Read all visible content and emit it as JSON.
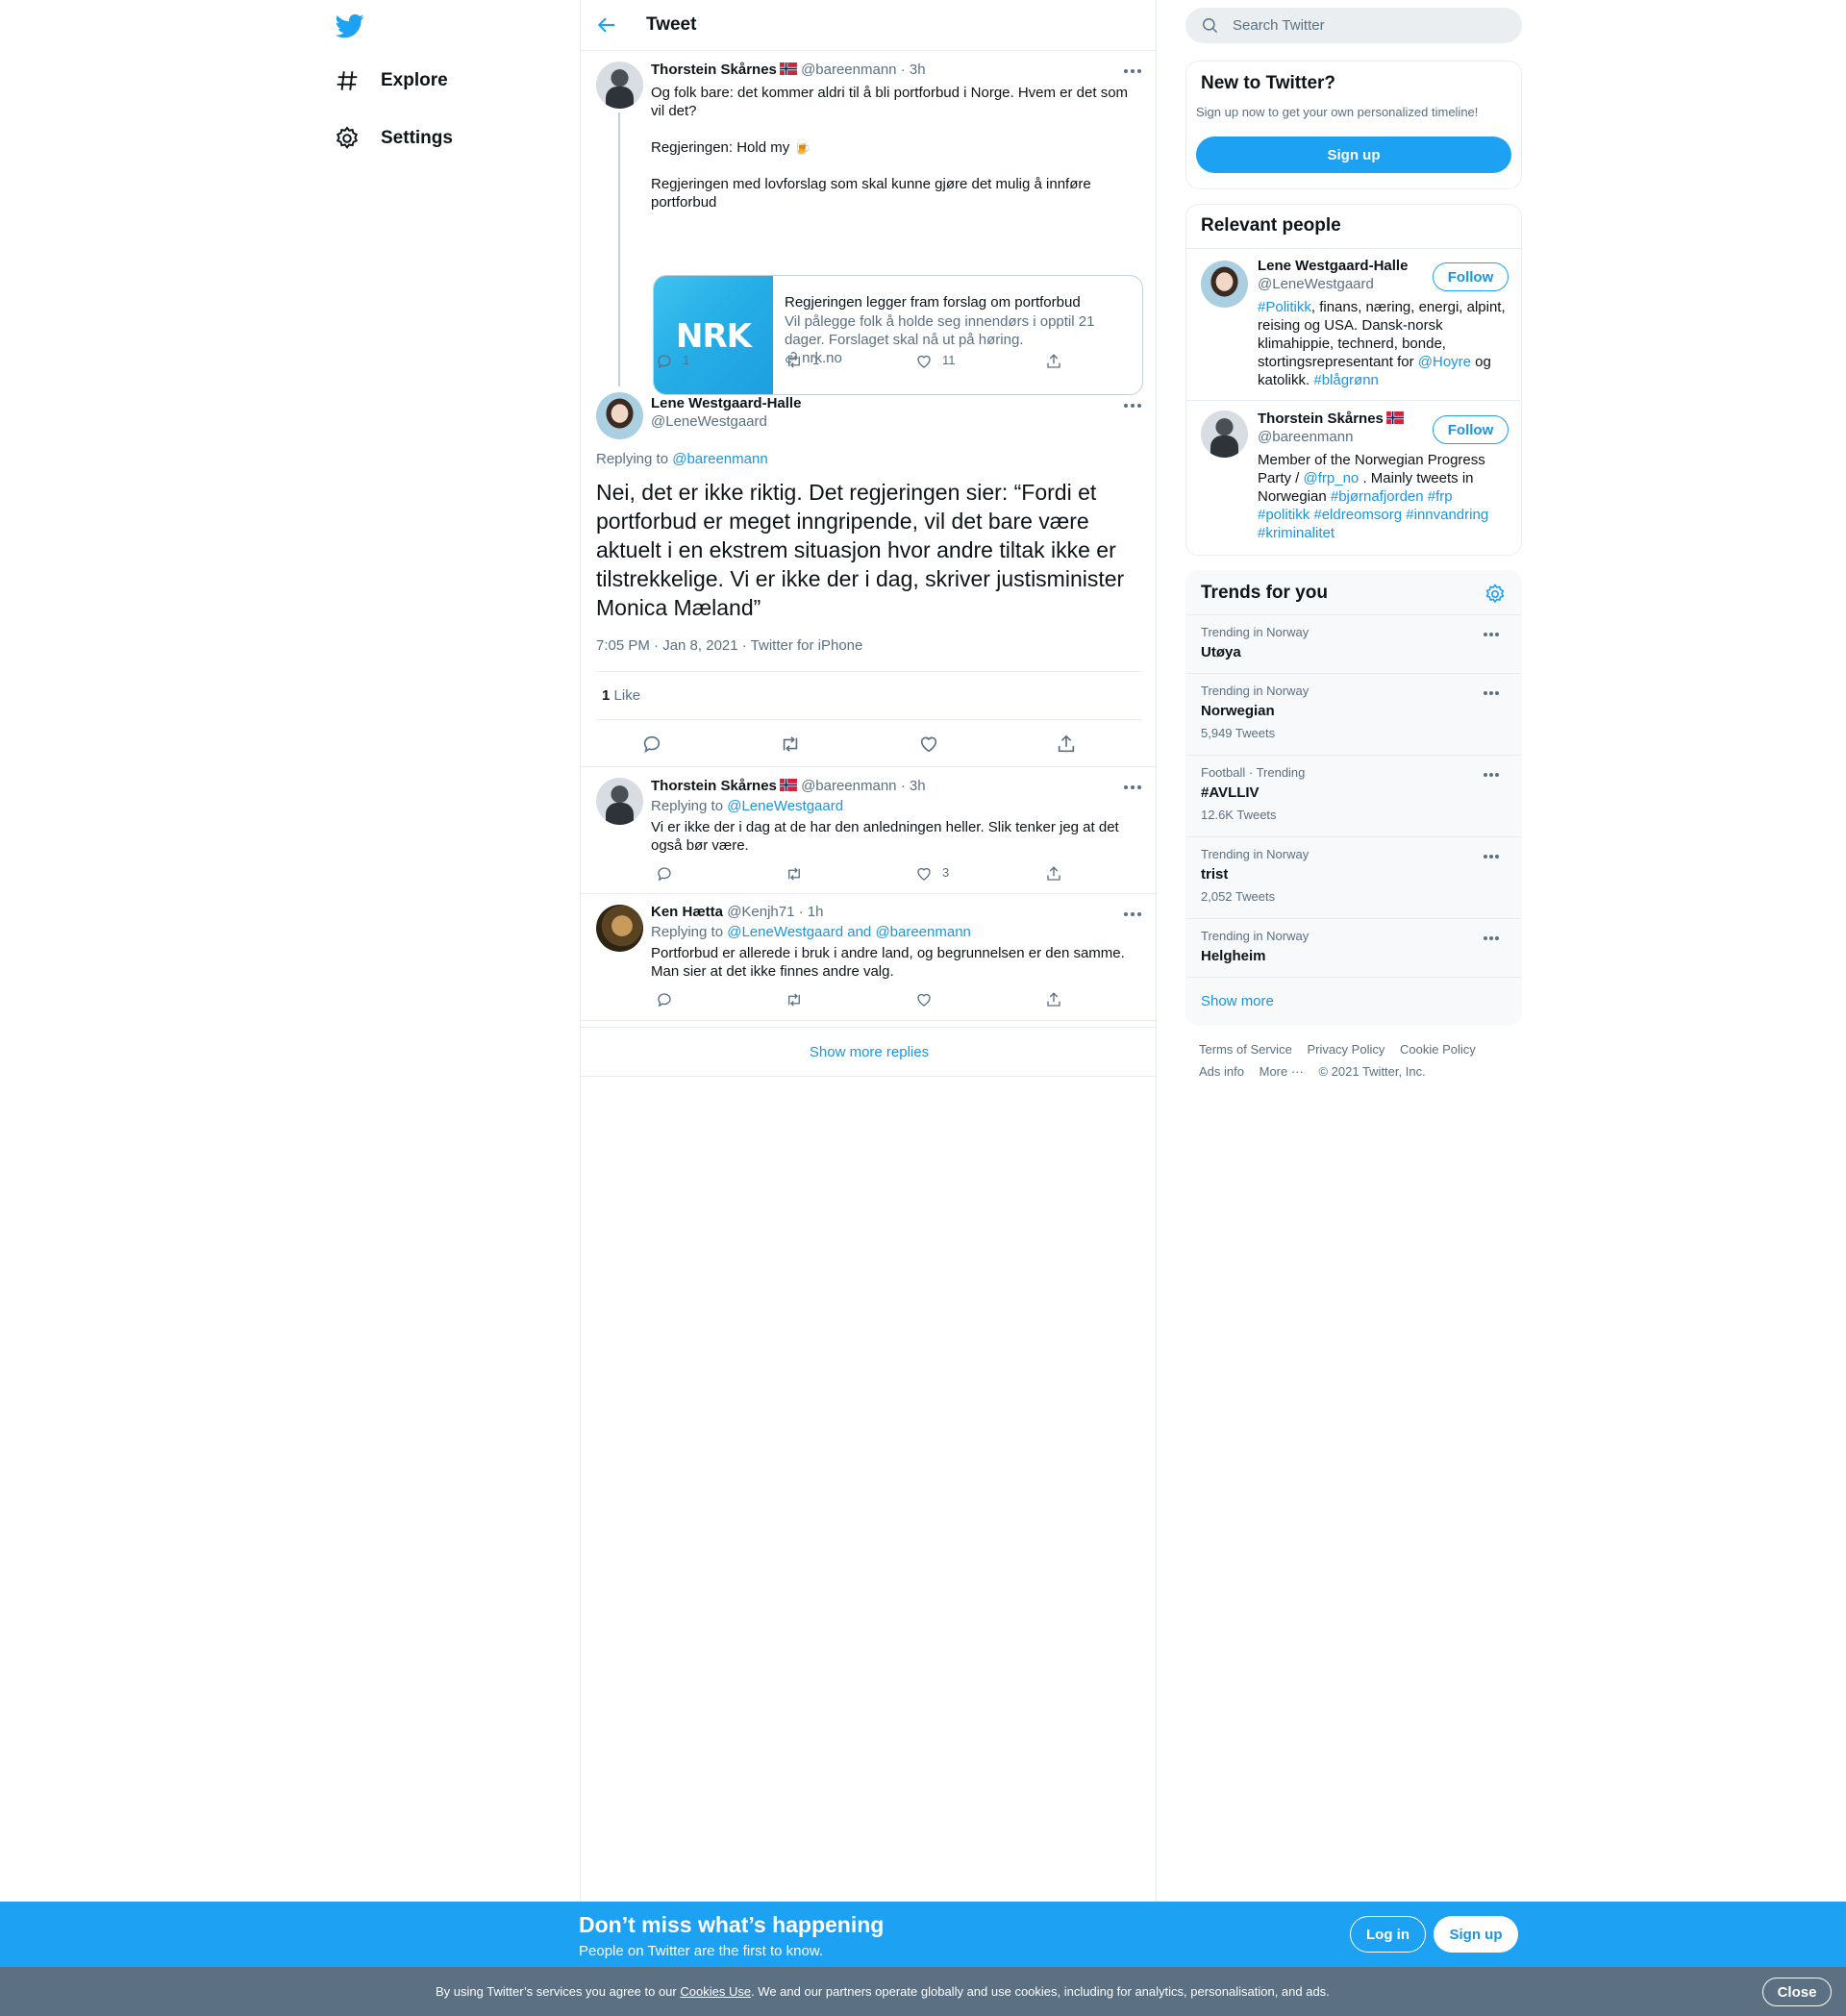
{
  "nav": {
    "items": [
      {
        "label": "Explore",
        "icon": "hashtag-icon"
      },
      {
        "label": "Settings",
        "icon": "gear-icon"
      }
    ]
  },
  "header": {
    "title": "Tweet"
  },
  "parent_tweet": {
    "name": "Thorstein Skårnes",
    "handle": "@bareenmann",
    "time": "· 3h",
    "text1": "Og folk bare: det kommer aldri til å bli portforbud i Norge. Hvem er det som vil det?",
    "text2": "Regjeringen: Hold my 🍺",
    "text3": "Regjeringen med lovforslag som skal kunne gjøre det mulig å innføre portforbud",
    "card": {
      "logo": "NRK",
      "title": "Regjeringen legger fram forslag om portforbud",
      "desc": "Vil pålegge folk å holde seg innendørs i opptil 21 dager. Forslaget skal nå ut på høring.",
      "domain": "nrk.no"
    },
    "replies": "1",
    "retweets": "1",
    "likes": "11"
  },
  "focal_tweet": {
    "name": "Lene Westgaard-Halle",
    "handle": "@LeneWestgaard",
    "replying_label": "Replying to",
    "replying_to": "@bareenmann",
    "text": "Nei, det er ikke riktig. Det regjeringen sier: “Fordi et portforbud er meget inngripende, vil det bare være aktuelt i en ekstrem situasjon hvor andre tiltak ikke er tilstrekkelige. Vi er ikke der i dag, skriver justisminister Monica Mæland”",
    "meta": "7:05 PM · Jan 8, 2021 · Twitter for iPhone",
    "like_count": "1",
    "like_label": "Like"
  },
  "replies": [
    {
      "name": "Thorstein Skårnes",
      "handle": "@bareenmann",
      "time": "· 3h",
      "replying_label": "Replying to",
      "replying_to": "@LeneWestgaard",
      "text": "Vi er ikke der i dag at de har den anledningen heller. Slik tenker jeg at det også bør være.",
      "replies": "",
      "retweets": "",
      "likes": "3"
    },
    {
      "name": "Ken Hætta",
      "handle": "@Kenjh71",
      "time": "· 1h",
      "replying_label": "Replying to",
      "replying_to": "@LeneWestgaard and @bareenmann",
      "text": "Portforbud er allerede i bruk i andre land, og begrunnelsen er den samme. Man sier at det ikke finnes andre valg.",
      "replies": "",
      "retweets": "",
      "likes": ""
    }
  ],
  "show_more_replies": "Show more replies",
  "search": {
    "placeholder": "Search Twitter"
  },
  "new_to_twitter": {
    "title": "New to Twitter?",
    "subtitle": "Sign up now to get your own personalized timeline!",
    "button": "Sign up"
  },
  "relevant_people": {
    "title": "Relevant people",
    "people": [
      {
        "name": "Lene Westgaard-Halle",
        "handle": "@LeneWestgaard",
        "follow": "Follow",
        "bio_parts": [
          "#Politikk",
          ", finans, næring, energi, alpint, reising og USA. Dansk-norsk klimahippie, technerd, bonde, stortingsrepresentant for ",
          "@Hoyre",
          " og katolikk. ",
          "#blågrønn"
        ]
      },
      {
        "name": "Thorstein Skårnes",
        "handle": "@bareenmann",
        "follow": "Follow",
        "bio_parts": [
          "Member of the Norwegian Progress Party / ",
          "@frp_no",
          " . Mainly tweets in Norwegian ",
          "#bjørnafjorden",
          " ",
          "#frp",
          " ",
          "#politikk",
          " ",
          "#eldreomsorg",
          " ",
          "#innvandring",
          " ",
          "#kriminalitet"
        ]
      }
    ]
  },
  "trends": {
    "title": "Trends for you",
    "items": [
      {
        "context": "Trending in Norway",
        "name": "Utøya",
        "count": ""
      },
      {
        "context": "Trending in Norway",
        "name": "Norwegian",
        "count": "5,949 Tweets"
      },
      {
        "context": "Football · Trending",
        "name": "#AVLLIV",
        "count": "12.6K Tweets"
      },
      {
        "context": "Trending in Norway",
        "name": "trist",
        "count": "2,052 Tweets"
      },
      {
        "context": "Trending in Norway",
        "name": "Helgheim",
        "count": ""
      }
    ],
    "show_more": "Show more"
  },
  "footer": {
    "links": [
      "Terms of Service",
      "Privacy Policy",
      "Cookie Policy",
      "Ads info",
      "More ···"
    ],
    "copyright": "© 2021 Twitter, Inc."
  },
  "bottom_bar": {
    "title": "Don’t miss what’s happening",
    "subtitle": "People on Twitter are the first to know.",
    "login": "Log in",
    "signup": "Sign up"
  },
  "cookie_bar": {
    "text_before": "By using Twitter’s services you agree to our ",
    "link": "Cookies Use",
    "text_after": ". We and our partners operate globally and use cookies, including for analytics, personalisation, and ads.",
    "close": "Close"
  },
  "colors": {
    "accent": "#1da1f2",
    "link": "#1b95e0",
    "secondary_text": "#5b7083",
    "cookie_bar": "#5b7083"
  }
}
